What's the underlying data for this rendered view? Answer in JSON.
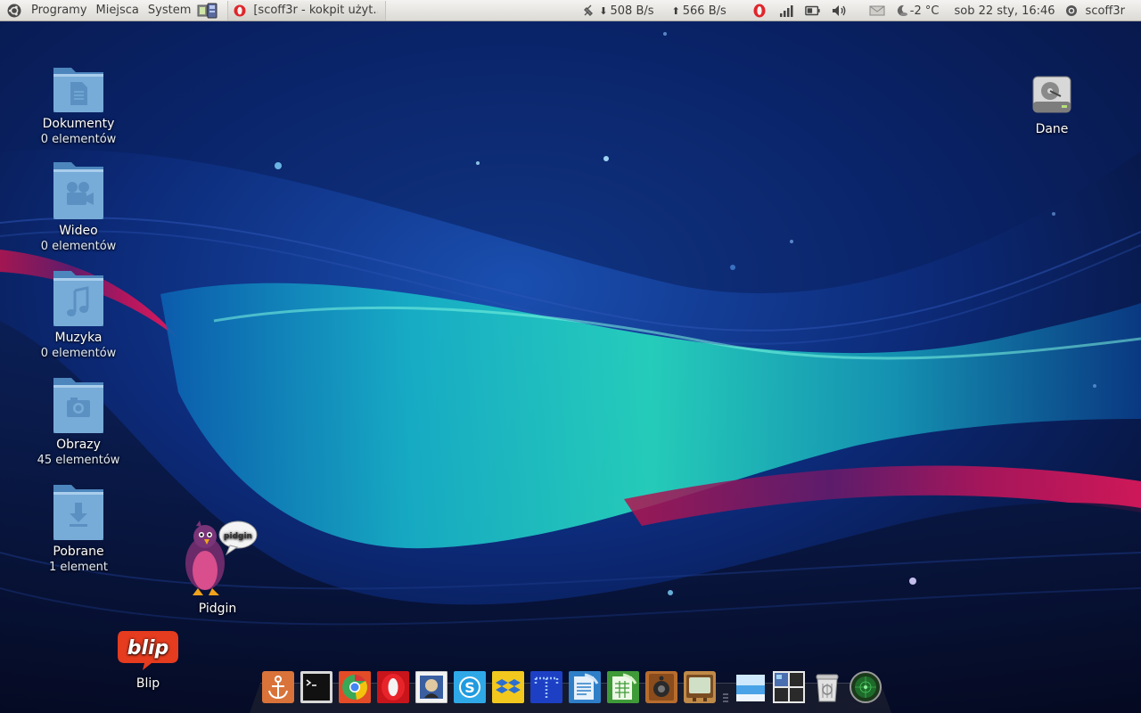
{
  "top_panel": {
    "menus": [
      "Programy",
      "Miejsca",
      "System"
    ],
    "active_window_title": "[scoff3r - kokpit użyt...",
    "download_speed": "508 B/s",
    "upload_speed": "566 B/s",
    "weather": "-2 °C",
    "clock": "sob 22 sty, 16:46",
    "user": "scoff3r"
  },
  "desktop": {
    "icons": [
      {
        "name": "Dokumenty",
        "count": "0 elementów",
        "icon": "documents-folder-icon"
      },
      {
        "name": "Wideo",
        "count": "0 elementów",
        "icon": "video-folder-icon"
      },
      {
        "name": "Muzyka",
        "count": "0 elementów",
        "icon": "music-folder-icon"
      },
      {
        "name": "Obrazy",
        "count": "45 elementów",
        "icon": "pictures-folder-icon"
      },
      {
        "name": "Pobrane",
        "count": "1 element",
        "icon": "downloads-folder-icon"
      }
    ],
    "pidgin": {
      "name": "Pidgin",
      "bubble": "pidgin"
    },
    "blip": {
      "name": "Blip",
      "logo": "blip"
    },
    "drive": {
      "name": "Dane"
    }
  },
  "dock": {
    "items": [
      "anchor-icon",
      "terminal-icon",
      "chrome-icon",
      "opera-icon",
      "mail-stamp-icon",
      "skype-icon",
      "dropbox-icon",
      "blue-grid-icon",
      "writer-icon",
      "calc-icon",
      "speaker-icon",
      "tv-icon",
      "separator",
      "home-folder-icon",
      "workspaces-icon",
      "trash-icon",
      "radar-icon"
    ]
  },
  "colors": {
    "panel_bg": "#e8e6e2",
    "folder_blue": "#6fa3d2",
    "wallpaper_teal": "#1fc8b8",
    "wallpaper_pink": "#e0195c"
  }
}
